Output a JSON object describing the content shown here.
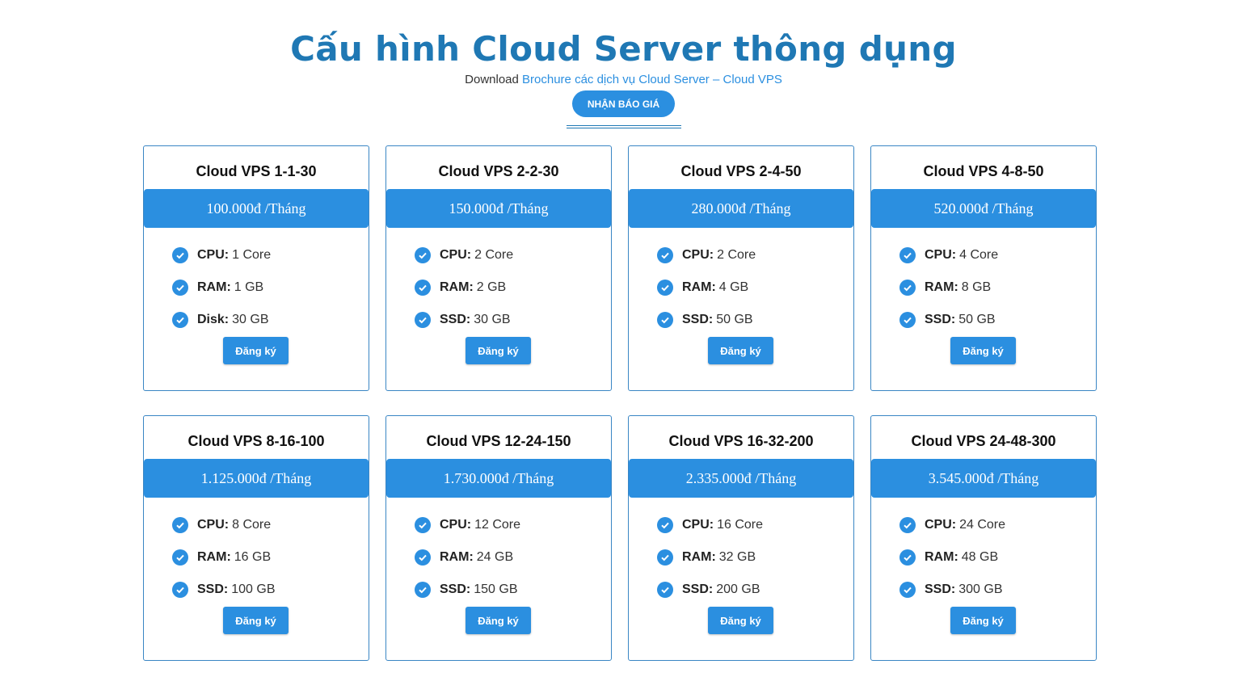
{
  "header": {
    "title": "Cấu hình Cloud Server thông dụng",
    "subtitle_prefix": "Download ",
    "subtitle_link": "Brochure các dịch vụ Cloud Server – Cloud VPS",
    "quote_button": "NHẬN BÁO GIÁ"
  },
  "colors": {
    "accent": "#2b8fe0",
    "title": "#1f78b4",
    "border": "#3a86c4"
  },
  "plans": [
    {
      "name": "Cloud VPS 1-1-30",
      "price": "100.000đ /Tháng",
      "specs": [
        {
          "key": "CPU:",
          "value": "1 Core"
        },
        {
          "key": "RAM:",
          "value": "1 GB"
        },
        {
          "key": "Disk:",
          "value": "30 GB"
        }
      ],
      "button": "Đăng ký"
    },
    {
      "name": "Cloud VPS 2-2-30",
      "price": "150.000đ /Tháng",
      "specs": [
        {
          "key": "CPU:",
          "value": "2 Core"
        },
        {
          "key": "RAM:",
          "value": "2 GB"
        },
        {
          "key": "SSD:",
          "value": "30 GB"
        }
      ],
      "button": "Đăng ký"
    },
    {
      "name": "Cloud VPS 2-4-50",
      "price": "280.000đ /Tháng",
      "specs": [
        {
          "key": "CPU:",
          "value": "2 Core"
        },
        {
          "key": "RAM:",
          "value": "4 GB"
        },
        {
          "key": "SSD:",
          "value": "50 GB"
        }
      ],
      "button": "Đăng ký"
    },
    {
      "name": "Cloud VPS 4-8-50",
      "price": "520.000đ /Tháng",
      "specs": [
        {
          "key": "CPU:",
          "value": "4 Core"
        },
        {
          "key": "RAM:",
          "value": "8 GB"
        },
        {
          "key": "SSD:",
          "value": "50 GB"
        }
      ],
      "button": "Đăng ký"
    },
    {
      "name": "Cloud VPS 8-16-100",
      "price": "1.125.000đ /Tháng",
      "specs": [
        {
          "key": "CPU:",
          "value": "8 Core"
        },
        {
          "key": "RAM:",
          "value": "16 GB"
        },
        {
          "key": "SSD:",
          "value": "100 GB"
        }
      ],
      "button": "Đăng ký"
    },
    {
      "name": "Cloud VPS 12-24-150",
      "price": "1.730.000đ /Tháng",
      "specs": [
        {
          "key": "CPU:",
          "value": "12 Core"
        },
        {
          "key": "RAM:",
          "value": "24 GB"
        },
        {
          "key": "SSD:",
          "value": "150 GB"
        }
      ],
      "button": "Đăng ký"
    },
    {
      "name": "Cloud VPS 16-32-200",
      "price": "2.335.000đ /Tháng",
      "specs": [
        {
          "key": "CPU:",
          "value": "16 Core"
        },
        {
          "key": "RAM:",
          "value": "32 GB"
        },
        {
          "key": "SSD:",
          "value": "200 GB"
        }
      ],
      "button": "Đăng ký"
    },
    {
      "name": "Cloud VPS 24-48-300",
      "price": "3.545.000đ /Tháng",
      "specs": [
        {
          "key": "CPU:",
          "value": "24 Core"
        },
        {
          "key": "RAM:",
          "value": "48 GB"
        },
        {
          "key": "SSD:",
          "value": "300 GB"
        }
      ],
      "button": "Đăng ký"
    }
  ]
}
